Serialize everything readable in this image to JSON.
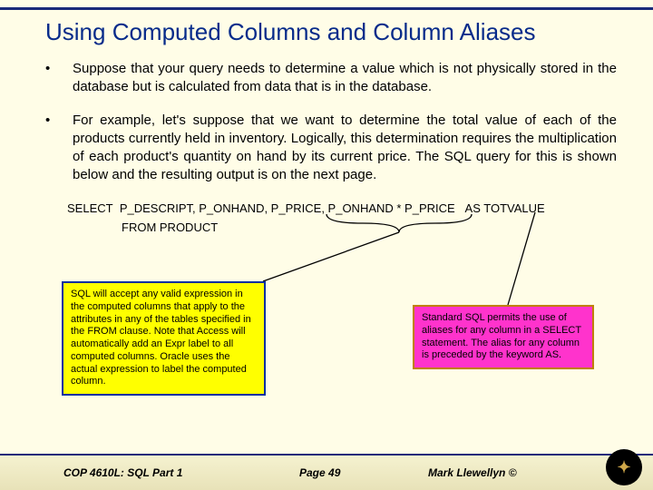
{
  "title": "Using Computed Columns and Column Aliases",
  "bullets": [
    "Suppose that your query needs to determine a value which is not physically stored in the database but is calculated from data that is in the database.",
    "For example, let's suppose that we want to determine the total value of each of the products currently held in inventory.  Logically, this determination requires the multiplication of each product's quantity on hand by its current price.  The SQL query for this is shown below and the resulting output is on the next page."
  ],
  "sql": {
    "select": "SELECT",
    "cols": "P_DESCRIPT, P_ONHAND, P_PRICE, P_ONHAND * P_PRICE",
    "as": "AS",
    "alias": " TOTVALUE",
    "from": "FROM PRODUCT"
  },
  "callouts": {
    "yellow": "SQL will accept any valid expression in the computed columns that apply to the attributes in any of the tables specified in the FROM clause.   Note that Access will automatically add an Expr label to all computed columns.  Oracle uses the actual expression to label the computed column.",
    "magenta": "Standard SQL permits the use of aliases for any column in a SELECT statement.  The alias for any column is preceded by the keyword AS."
  },
  "footer": {
    "course": "COP 4610L: SQL Part 1",
    "page": "Page 49",
    "author": "Mark Llewellyn ©"
  }
}
